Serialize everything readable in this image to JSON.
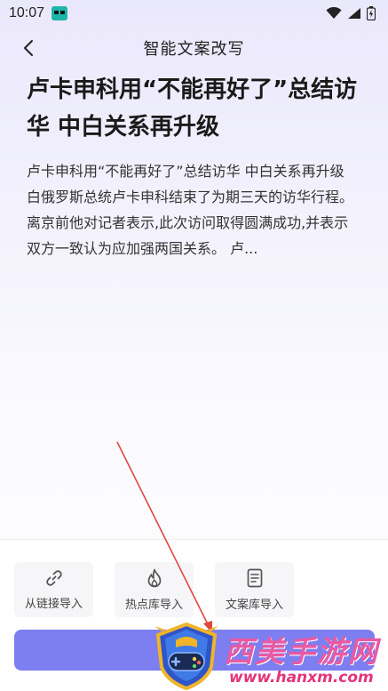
{
  "status_bar": {
    "time": "10:07"
  },
  "header": {
    "title": "智能文案改写"
  },
  "article": {
    "headline": "卢卡申科用“不能再好了”总结访华 中白关系再升级",
    "body": "卢卡申科用“不能再好了”总结访华 中白关系再升级 白俄罗斯总统卢卡申科结束了为期三天的访华行程。离京前他对记者表示,此次访问取得圆满成功,并表示双方一致认为应加强两国关系。 卢..."
  },
  "import_options": [
    {
      "label": "从链接导入",
      "icon": "link-icon"
    },
    {
      "label": "热点库导入",
      "icon": "flame-icon"
    },
    {
      "label": "文案库导入",
      "icon": "document-icon"
    }
  ],
  "watermark": {
    "title": "西美手游网",
    "url": "www.hanxm.com"
  },
  "colors": {
    "primary_button": "#7d7ef0",
    "arrow": "#e0473e",
    "watermark_pink": "#e85aa3"
  }
}
